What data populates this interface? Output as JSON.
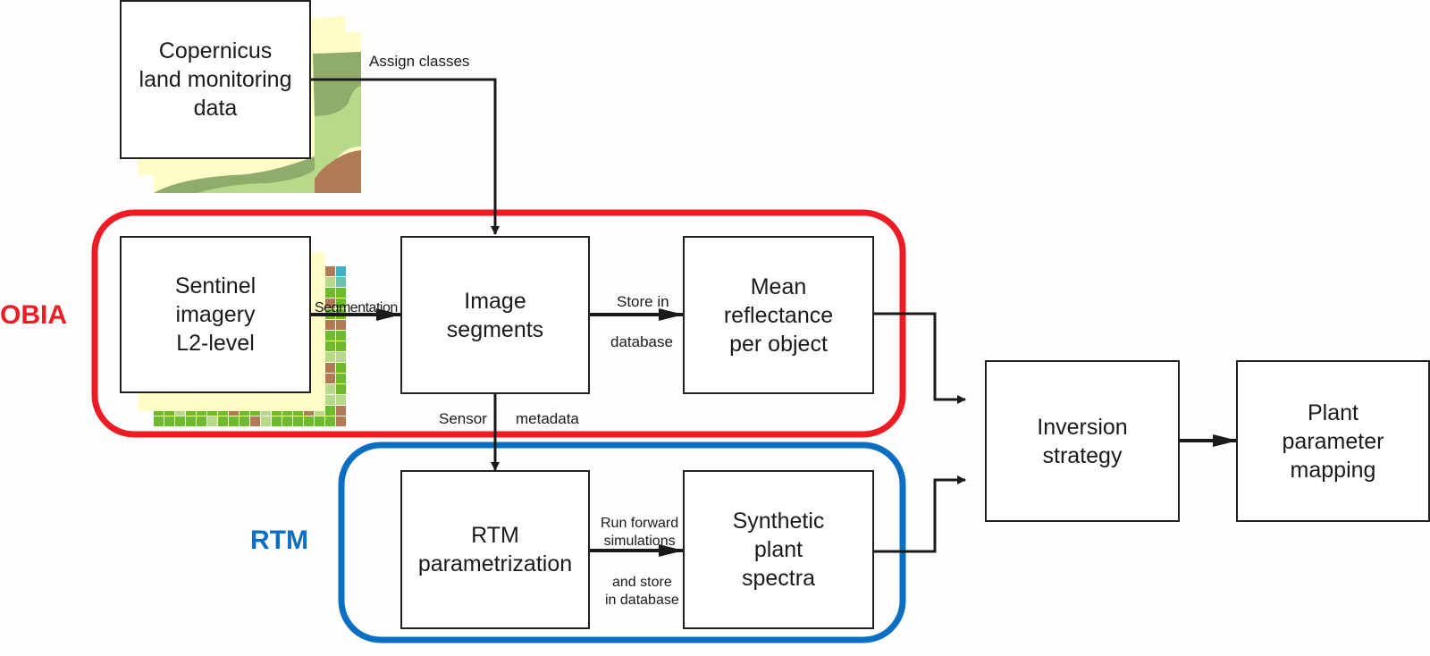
{
  "colors": {
    "obia": "#ee1c25",
    "rtm": "#0a6fc2",
    "line": "#1a1a1a",
    "paper_yellow": "#fffcc8",
    "green_dark": "#8fac6a",
    "green_light": "#b7d98a",
    "green_pixel": "#6dbb2a",
    "brown": "#b07a55",
    "teal": "#3fb0c8"
  },
  "groups": {
    "obia": {
      "label": "OBIA"
    },
    "rtm": {
      "label": "RTM"
    }
  },
  "nodes": {
    "copernicus": {
      "label": "Copernicus\nland monitoring\ndata"
    },
    "sentinel": {
      "label": "Sentinel\nimagery\nL2-level"
    },
    "segments": {
      "label": "Image\nsegments"
    },
    "reflectance": {
      "label": "Mean\nreflectance\nper object"
    },
    "rtm_param": {
      "label": "RTM\nparametrization"
    },
    "synthetic": {
      "label": "Synthetic\nplant\nspectra"
    },
    "inversion": {
      "label": "Inversion\nstrategy"
    },
    "mapping": {
      "label": "Plant\nparameter\nmapping"
    }
  },
  "edges": {
    "assign": {
      "label": "Assign classes"
    },
    "segmentation": {
      "label": "Segmentation"
    },
    "store_top": {
      "label": "Store in"
    },
    "store_bottom": {
      "label": "database"
    },
    "sensor": {
      "label": "Sensor"
    },
    "metadata": {
      "label": "metadata"
    },
    "run_top": {
      "label": "Run forward\nsimulations"
    },
    "run_bottom": {
      "label": "and store\nin database"
    }
  }
}
